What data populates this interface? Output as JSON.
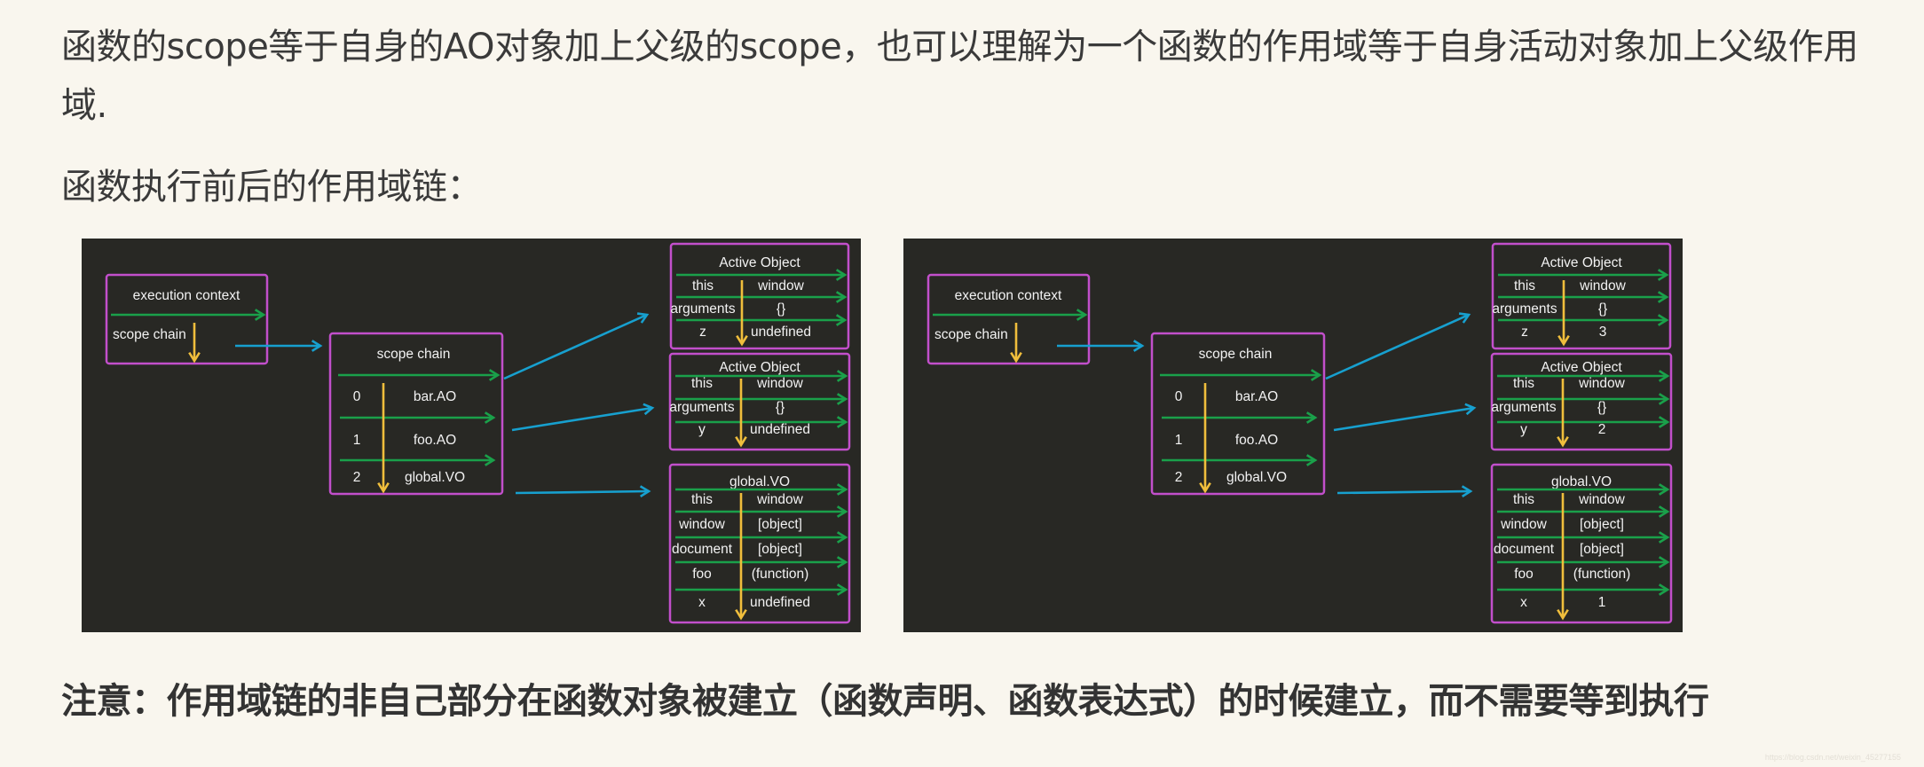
{
  "paragraphs": {
    "intro": "函数的scope等于自身的AO对象加上父级的scope，也可以理解为一个函数的作用域等于自身活动对象加上父级作用域.",
    "subtitle": "函数执行前后的作用域链：",
    "note": "注意：作用域链的非自己部分在函数对象被建立（函数声明、函数表达式）的时候建立，而不需要等到执行"
  },
  "colors": {
    "background": "#f9f6ee",
    "diagram_background": "#282824",
    "box_border": "#c24fcb",
    "green_arrow": "#1aa04a",
    "yellow_arrow": "#f0be3c",
    "blue_arrow": "#17a0cf"
  },
  "diagrams": [
    {
      "label": "before-execution",
      "execution_context": {
        "title": "execution context",
        "field": "scope chain"
      },
      "scope_chain": {
        "title": "scope chain",
        "items": [
          {
            "index": "0",
            "ref": "bar.AO"
          },
          {
            "index": "1",
            "ref": "foo.AO"
          },
          {
            "index": "2",
            "ref": "global.VO"
          }
        ]
      },
      "bar_ao": {
        "title": "Active Object",
        "rows": [
          {
            "key": "this",
            "value": "window"
          },
          {
            "key": "arguments",
            "value": "{}"
          },
          {
            "key": "z",
            "value": "undefined"
          }
        ]
      },
      "foo_ao": {
        "title": "Active Object",
        "rows": [
          {
            "key": "this",
            "value": "window"
          },
          {
            "key": "arguments",
            "value": "{}"
          },
          {
            "key": "y",
            "value": "undefined"
          }
        ]
      },
      "global_vo": {
        "title": "global.VO",
        "rows": [
          {
            "key": "this",
            "value": "window"
          },
          {
            "key": "window",
            "value": "[object]"
          },
          {
            "key": "document",
            "value": "[object]"
          },
          {
            "key": "foo",
            "value": "(function)"
          },
          {
            "key": "x",
            "value": "undefined"
          }
        ]
      }
    },
    {
      "label": "after-execution",
      "execution_context": {
        "title": "execution context",
        "field": "scope chain"
      },
      "scope_chain": {
        "title": "scope chain",
        "items": [
          {
            "index": "0",
            "ref": "bar.AO"
          },
          {
            "index": "1",
            "ref": "foo.AO"
          },
          {
            "index": "2",
            "ref": "global.VO"
          }
        ]
      },
      "bar_ao": {
        "title": "Active Object",
        "rows": [
          {
            "key": "this",
            "value": "window"
          },
          {
            "key": "arguments",
            "value": "{}"
          },
          {
            "key": "z",
            "value": "3"
          }
        ]
      },
      "foo_ao": {
        "title": "Active Object",
        "rows": [
          {
            "key": "this",
            "value": "window"
          },
          {
            "key": "arguments",
            "value": "{}"
          },
          {
            "key": "y",
            "value": "2"
          }
        ]
      },
      "global_vo": {
        "title": "global.VO",
        "rows": [
          {
            "key": "this",
            "value": "window"
          },
          {
            "key": "window",
            "value": "[object]"
          },
          {
            "key": "document",
            "value": "[object]"
          },
          {
            "key": "foo",
            "value": "(function)"
          },
          {
            "key": "x",
            "value": "1"
          }
        ]
      }
    }
  ],
  "watermark": "https://blog.csdn.net/weixin_45277155"
}
